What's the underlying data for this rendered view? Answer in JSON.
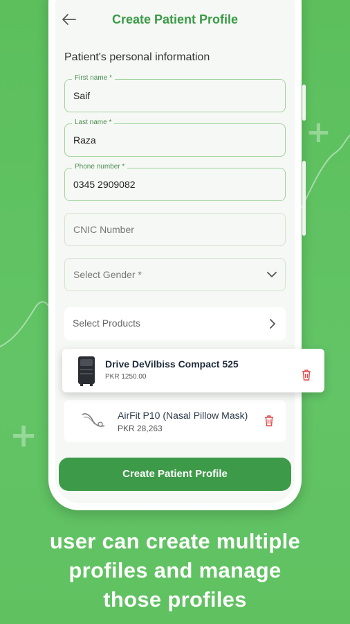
{
  "header": {
    "title": "Create Patient Profile",
    "back_icon": "arrow-left-icon"
  },
  "section_title": "Patient's personal information",
  "fields": {
    "first_name": {
      "label": "First name *",
      "value": "Saif"
    },
    "last_name": {
      "label": "Last name *",
      "value": "Raza"
    },
    "phone": {
      "label": "Phone number *",
      "value": "0345 2909082"
    },
    "cnic": {
      "placeholder": "CNIC Number"
    },
    "gender": {
      "placeholder": "Select Gender *"
    }
  },
  "select_products": {
    "label": "Select Products"
  },
  "products": [
    {
      "name": "Drive DeVilbiss Compact 525",
      "price": "PKR 1250.00"
    },
    {
      "name": "AirFit P10 (Nasal Pillow Mask)",
      "price": "PKR 28,263"
    }
  ],
  "cta_label": "Create Patient Profile",
  "caption": [
    "user can create multiple",
    "profiles and manage",
    "those profiles"
  ],
  "colors": {
    "brand_green": "#3d9a48",
    "background": "#5fc160",
    "delete_red": "#e04848"
  }
}
